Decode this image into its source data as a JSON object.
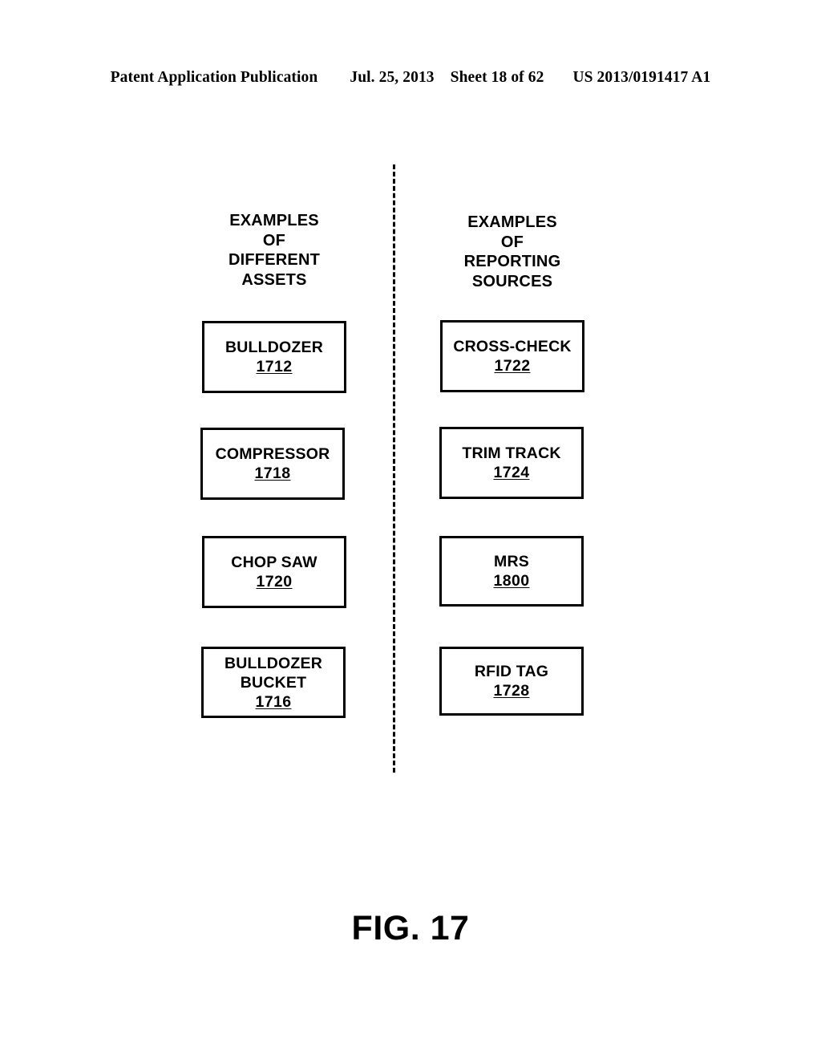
{
  "page_header": {
    "publication": "Patent Application Publication",
    "date": "Jul. 25, 2013",
    "sheet": "Sheet 18 of 62",
    "patent_number": "US 2013/0191417 A1"
  },
  "figure": {
    "caption": "FIG. 17",
    "divider": "vertical-dashed-line",
    "columns": [
      {
        "id": "assets",
        "heading": "EXAMPLES\nOF\nDIFFERENT\nASSETS",
        "boxes": [
          {
            "label": "BULLDOZER",
            "ref": "1712"
          },
          {
            "label": "COMPRESSOR",
            "ref": "1718"
          },
          {
            "label": "CHOP SAW",
            "ref": "1720"
          },
          {
            "label": "BULLDOZER\nBUCKET",
            "ref": "1716"
          }
        ]
      },
      {
        "id": "reporting-sources",
        "heading": "EXAMPLES\nOF\nREPORTING\nSOURCES",
        "boxes": [
          {
            "label": "CROSS-CHECK",
            "ref": "1722"
          },
          {
            "label": "TRIM TRACK",
            "ref": "1724"
          },
          {
            "label": "MRS",
            "ref": "1800"
          },
          {
            "label": "RFID TAG",
            "ref": "1728"
          }
        ]
      }
    ]
  },
  "colors": {
    "ink": "#000000",
    "paper": "#ffffff"
  }
}
